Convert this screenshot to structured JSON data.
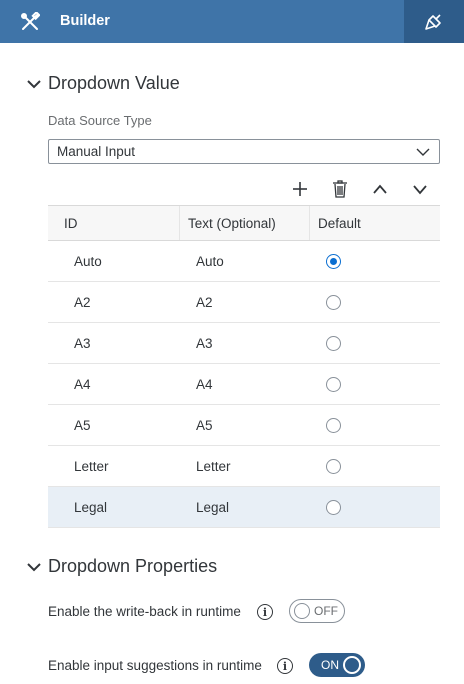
{
  "header": {
    "title": "Builder",
    "tools_icon": "tools-icon",
    "styling_icon": "paintbrush-icon",
    "background": "#3f74a8",
    "active_tab_background": "#2e5c8a"
  },
  "dropdown_value": {
    "section_title": "Dropdown Value",
    "data_source_label": "Data Source Type",
    "data_source_value": "Manual Input",
    "toolbar": {
      "add_icon": "plus-icon",
      "delete_icon": "trash-icon",
      "move_up_icon": "chevron-up-icon",
      "move_down_icon": "chevron-down-icon"
    },
    "table": {
      "columns": [
        "ID",
        "Text (Optional)",
        "Default"
      ],
      "rows": [
        {
          "id": "Auto",
          "text": "Auto",
          "default": true
        },
        {
          "id": "A2",
          "text": "A2",
          "default": false
        },
        {
          "id": "A3",
          "text": "A3",
          "default": false
        },
        {
          "id": "A4",
          "text": "A4",
          "default": false
        },
        {
          "id": "A5",
          "text": "A5",
          "default": false
        },
        {
          "id": "Letter",
          "text": "Letter",
          "default": false
        },
        {
          "id": "Legal",
          "text": "Legal",
          "default": false
        }
      ],
      "selected_row": 6
    }
  },
  "dropdown_properties": {
    "section_title": "Dropdown Properties",
    "write_back": {
      "label": "Enable the write-back in runtime",
      "state": "OFF"
    },
    "input_suggestions": {
      "label": "Enable input suggestions in runtime",
      "state": "ON"
    }
  }
}
